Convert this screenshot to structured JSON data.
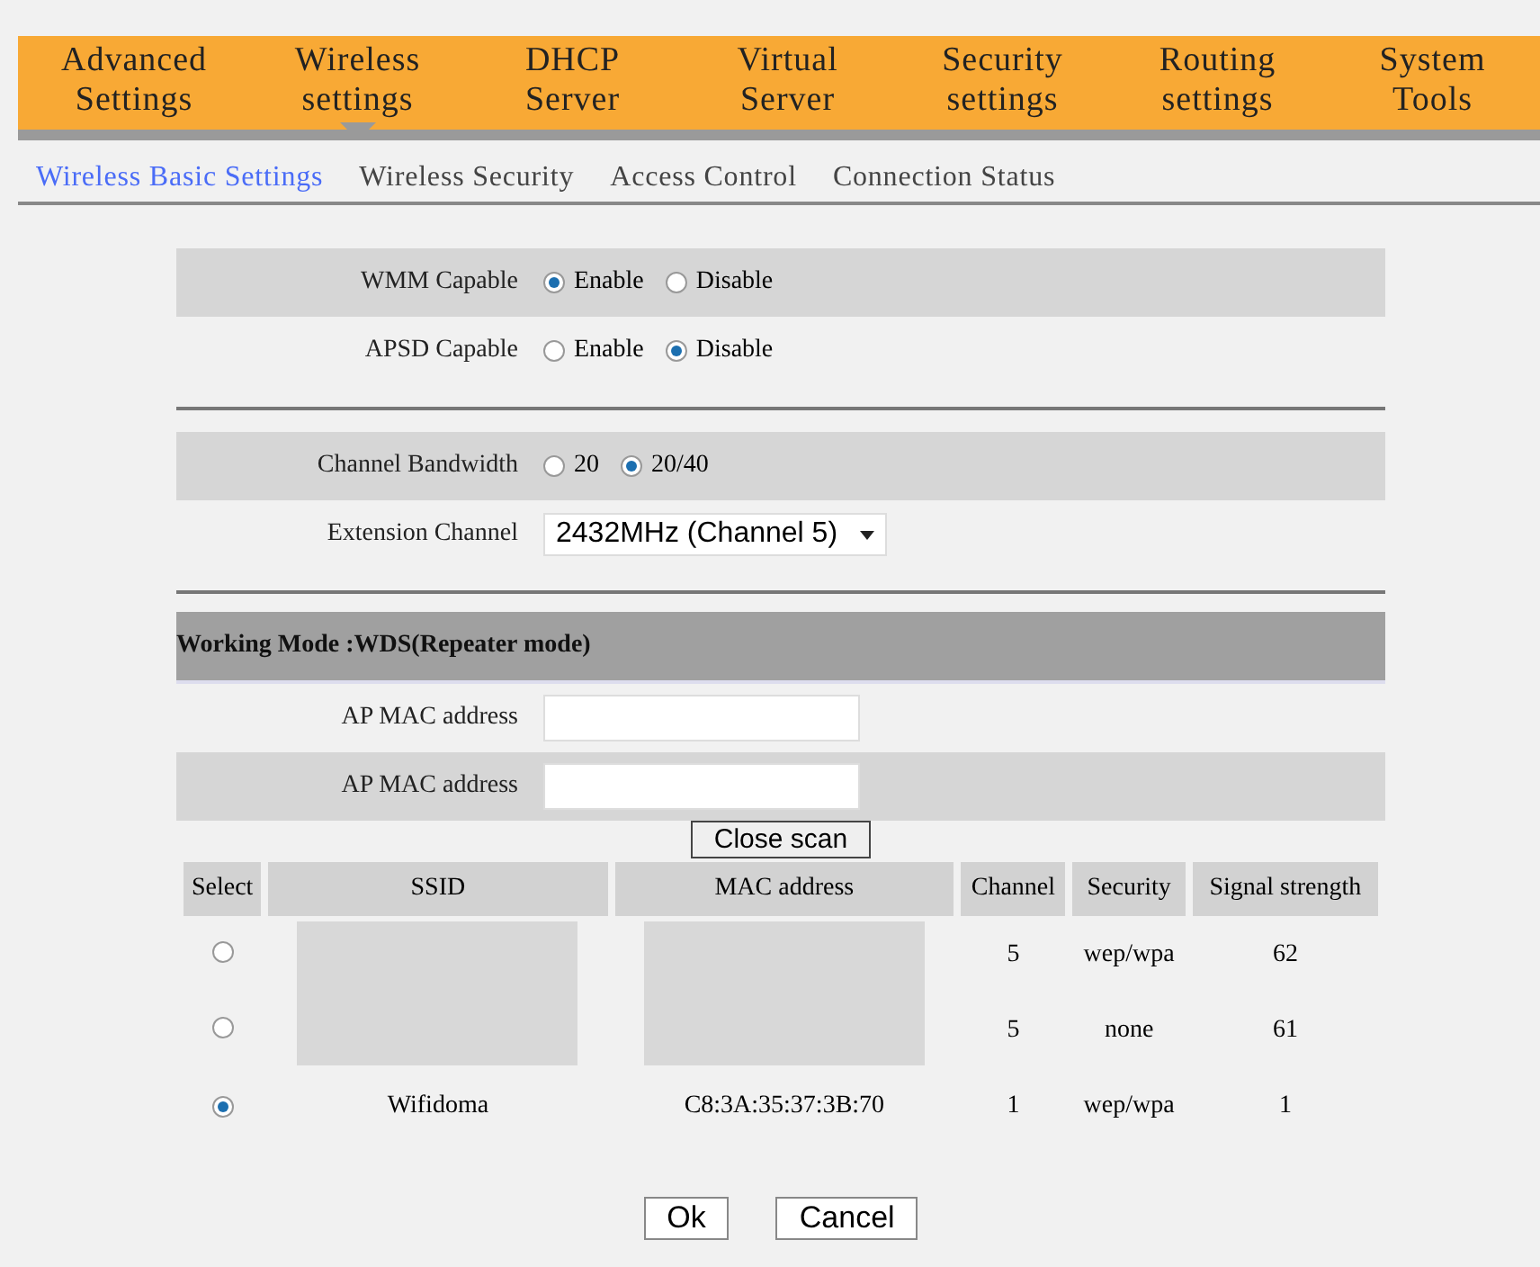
{
  "nav": [
    {
      "label": "Advanced Settings",
      "selected": false
    },
    {
      "label": "Wireless settings",
      "selected": true
    },
    {
      "label": "DHCP Server",
      "selected": false
    },
    {
      "label": "Virtual Server",
      "selected": false
    },
    {
      "label": "Security settings",
      "selected": false
    },
    {
      "label": "Routing settings",
      "selected": false
    },
    {
      "label": "System Tools",
      "selected": false
    }
  ],
  "subnav": [
    {
      "label": "Wireless Basic Settings",
      "selected": true
    },
    {
      "label": "Wireless Security",
      "selected": false
    },
    {
      "label": "Access Control",
      "selected": false
    },
    {
      "label": "Connection Status",
      "selected": false
    }
  ],
  "radio_rows": [
    {
      "label": "WMM Capable",
      "shaded": true,
      "options": [
        {
          "label": "Enable",
          "selected": true
        },
        {
          "label": "Disable",
          "selected": false
        }
      ]
    },
    {
      "label": "APSD Capable",
      "shaded": false,
      "options": [
        {
          "label": "Enable",
          "selected": false
        },
        {
          "label": "Disable",
          "selected": true
        }
      ]
    }
  ],
  "bandwidth": {
    "label": "Channel Bandwidth",
    "options": [
      {
        "label": "20",
        "selected": false
      },
      {
        "label": "20/40",
        "selected": true
      }
    ]
  },
  "extension": {
    "label": "Extension Channel",
    "value": "2432MHz (Channel 5)"
  },
  "wds": {
    "title": "Working Mode :WDS(Repeater mode)",
    "fields": [
      {
        "label": "AP MAC address",
        "shaded": false
      },
      {
        "label": "AP MAC address",
        "shaded": true
      }
    ],
    "scan_button": "Close scan"
  },
  "table": {
    "columns": [
      "Select",
      "SSID",
      "MAC address",
      "Channel",
      "Security",
      "Signal strength"
    ],
    "rows": [
      {
        "selected": false,
        "redacted": true,
        "ssid": "",
        "mac": "",
        "channel": "5",
        "security": "wep/wpa",
        "signal": "62"
      },
      {
        "selected": false,
        "redacted": true,
        "ssid": "",
        "mac": "",
        "channel": "5",
        "security": "none",
        "signal": "61"
      },
      {
        "selected": true,
        "redacted": false,
        "ssid": "Wifidoma",
        "mac": "C8:3A:35:37:3B:70",
        "channel": "1",
        "security": "wep/wpa",
        "signal": "1"
      }
    ]
  },
  "buttons": [
    "Ok",
    "Cancel"
  ]
}
